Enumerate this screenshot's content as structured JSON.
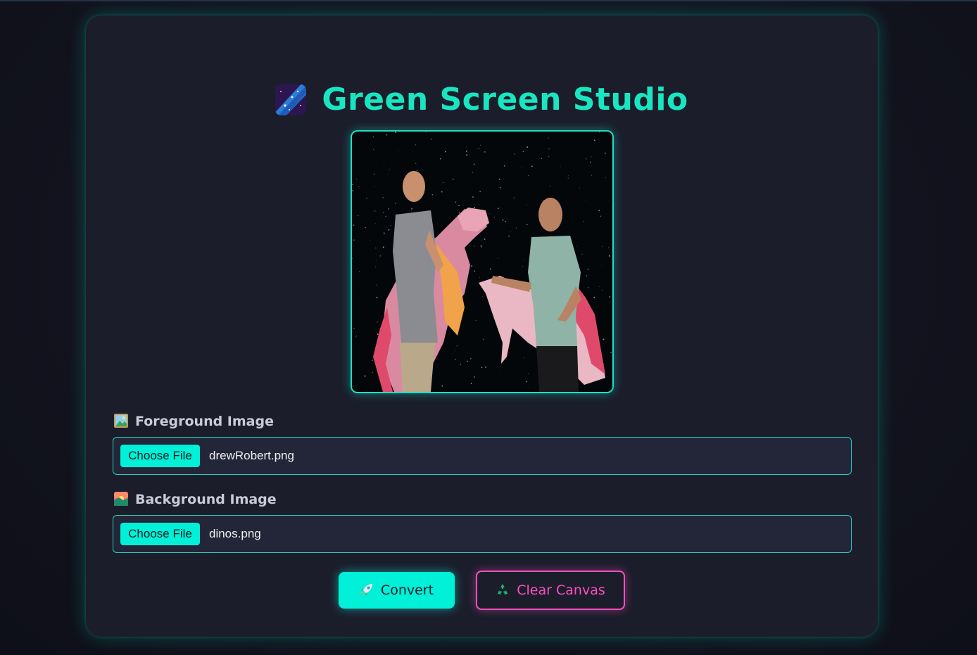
{
  "app": {
    "title": "Green Screen Studio",
    "title_icon": "milky-way-icon",
    "accent_color": "#19e6c0",
    "secondary_color": "#ff4fc0"
  },
  "canvas": {
    "description_icon": "composite-output-canvas"
  },
  "foreground": {
    "label": "Foreground Image",
    "icon": "framed-picture-icon",
    "button_label": "Choose File",
    "file_name": "drewRobert.png"
  },
  "background": {
    "label": "Background Image",
    "icon": "sunrise-icon",
    "button_label": "Choose File",
    "file_name": "dinos.png"
  },
  "actions": {
    "convert_label": "Convert",
    "convert_icon": "rocket-icon",
    "clear_label": "Clear Canvas",
    "clear_icon": "recycle-icon"
  }
}
